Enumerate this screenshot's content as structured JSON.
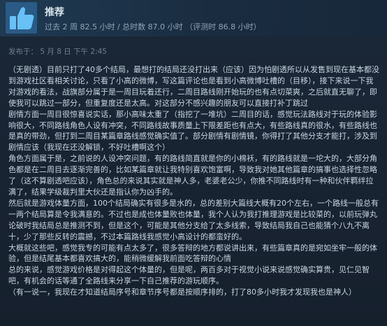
{
  "review": {
    "verdict": "推荐",
    "hours": "过去 2 周 82.5 小时 / 总时数 87.0 小时  （评测时 86.8 小时）",
    "posted": "发布于：  5 月 8 日 下午 2:45",
    "icon": "thumbs-up-icon",
    "paragraphs": [
      "（无剧透）目前只打了40多个结局，最想打的结局还没打出来（应该）因为怕剧透所以从发售到现在基本都没到游戏社区看相关讨论，只看了小高的微博，写这篇评论也是看到小高微博吐槽的（目移），接下来说一下我对游戏的看法，战旗部分属于是一周目玩着还行，二周目路线刚开始玩的也有点切菜爽，之后就直无聊了，即使我可以跳过一部分，但重复度还是太高。对这部分不感兴趣的朋友可以直接打补丁跳过",
      "剧情方面一周目很惊喜说实话，那小高味太重了（指挖了一堆坑）二周目的话，感觉玩法路线对于玩的体验影响很大，不同路线角色人设有冲突，不同路线故事质量上下限差距也有点大，有些路线真的很水，有些路线也是真的带劲，但打到二周目某篇章路线感觉确实值了。部分剧情有剧情镜，你得打了其他分支才能打，涉及到剧情应该（我现在还没解锁，不好吐槽啊这个）",
      "角色方面属于是，之前说的人设冲突问题，有的路线简直就是你的小棉袄，有的路线就是一坨大的，大部分角色都是在二周目去逐渐完善的，比如某篇章就让我特别喜欢饱富啊，导致我对她其他篇章的搞事也选择性忽略了（这不算剧透吧应该），角色总的来说其实就是神人多，老婆老公少，你推不同路线时有一种和伙伴羁绊拉满了，结果学级裁判里大伙还是指认你为凶手的。",
      "然后就是游戏体量方面，100个结局确实有很多是水的，总的差别大篇线大概有20个左右，一个路线一般总有一两个结局算是令我满意的。不过也是成也体量败也体量，我个人认为我打推理游戏是比较菜的，以前玩弹丸论破时我结局总是推测不到，但是这个，可能是其他分支给了太多线索，导致结局我自己也能猜个八九不离十，少了那些反转的震撼，不过本篇路线我感觉小高设计的都蛮好的。",
      "大概就这些吧，感觉我专的可能有点太多了，很多答辩的地方都说讲出来，有些篇章真的是宛如坐牢一般的体验，但是结尾基本都喜欢搞大的，能稍微缓解我前面吃答辩的心情",
      "总的来说，感觉游戏价格是对得起这个体量的，但是呢，两百多对于视觉小说来说感觉确实算贵，见仁见智吧，有机会的话等通了全路线来分享一下自己推荐的游玩顺序。",
      "（有一说一，我现在才知道结局序号和章节序号都是按顺序排的，打了80多小时我才发现我也是神人）"
    ]
  }
}
